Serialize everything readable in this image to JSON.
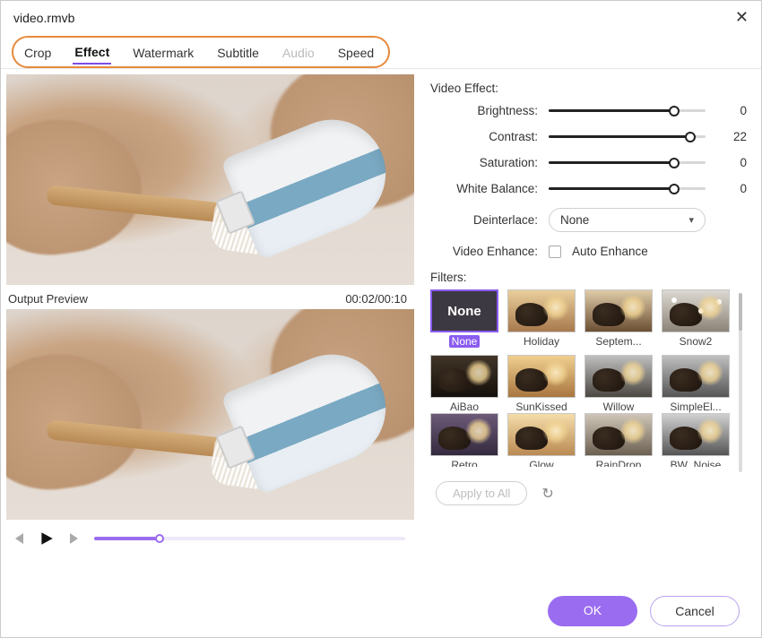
{
  "window": {
    "title": "video.rmvb"
  },
  "tabs": {
    "crop": "Crop",
    "effect": "Effect",
    "watermark": "Watermark",
    "subtitle": "Subtitle",
    "audio": "Audio",
    "speed": "Speed",
    "active": "effect",
    "disabled": [
      "audio"
    ]
  },
  "preview": {
    "output_label": "Output Preview",
    "timecode": "00:02/00:10"
  },
  "effects": {
    "section_title": "Video Effect:",
    "brightness": {
      "label": "Brightness:",
      "value": 0,
      "pos": 80
    },
    "contrast": {
      "label": "Contrast:",
      "value": 22,
      "pos": 90
    },
    "saturation": {
      "label": "Saturation:",
      "value": 0,
      "pos": 80
    },
    "white_balance": {
      "label": "White Balance:",
      "value": 0,
      "pos": 80
    },
    "deinterlace": {
      "label": "Deinterlace:",
      "selected": "None"
    },
    "video_enhance": {
      "label": "Video Enhance:",
      "checkbox_label": "Auto Enhance",
      "checked": false
    }
  },
  "filters": {
    "title": "Filters:",
    "selected": "None",
    "items": [
      {
        "id": "none",
        "label": "None",
        "cls": "none"
      },
      {
        "id": "holiday",
        "label": "Holiday",
        "cls": "holiday"
      },
      {
        "id": "september",
        "label": "Septem...",
        "cls": "september"
      },
      {
        "id": "snow2",
        "label": "Snow2",
        "cls": "snow"
      },
      {
        "id": "aibao",
        "label": "AiBao",
        "cls": "aibao"
      },
      {
        "id": "sunkissed",
        "label": "SunKissed",
        "cls": "sunkissed"
      },
      {
        "id": "willow",
        "label": "Willow",
        "cls": "willow"
      },
      {
        "id": "simpleel",
        "label": "SimpleEl...",
        "cls": "simpleel"
      },
      {
        "id": "retro",
        "label": "Retro",
        "cls": "retro"
      },
      {
        "id": "glow",
        "label": "Glow",
        "cls": "glow"
      },
      {
        "id": "raindrop",
        "label": "RainDrop",
        "cls": "raindrop"
      },
      {
        "id": "bwnoise",
        "label": "BW_Noise",
        "cls": "bwnoise"
      }
    ],
    "apply_all": "Apply to All"
  },
  "footer": {
    "ok": "OK",
    "cancel": "Cancel"
  }
}
